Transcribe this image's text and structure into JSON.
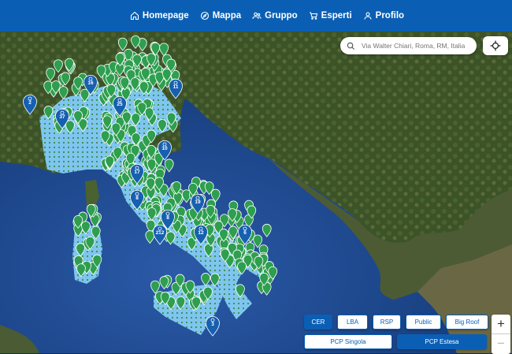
{
  "nav": {
    "items": [
      {
        "label": "Homepage",
        "icon": "home-icon"
      },
      {
        "label": "Mappa",
        "icon": "compass-icon"
      },
      {
        "label": "Gruppo",
        "icon": "group-icon"
      },
      {
        "label": "Esperti",
        "icon": "cart-icon"
      },
      {
        "label": "Profilo",
        "icon": "user-icon"
      }
    ]
  },
  "search": {
    "placeholder": "Via Walter Chiari, Roma, RM, Italia"
  },
  "filters": {
    "row1": [
      {
        "label": "CER",
        "active": true
      },
      {
        "label": "LBA",
        "active": false
      },
      {
        "label": "RSP",
        "active": false
      },
      {
        "label": "Public",
        "active": false
      },
      {
        "label": "Big Roof",
        "active": false
      }
    ],
    "row2": [
      {
        "label": "PCP Singola",
        "active": false
      },
      {
        "label": "PCP Estesa",
        "active": true
      }
    ]
  },
  "zoom": {
    "in": "+",
    "out": "−"
  },
  "clusters": [
    "2",
    "16",
    "37",
    "25",
    "11",
    "17",
    "8",
    "10",
    "8",
    "212",
    "19",
    "12",
    "6",
    "3"
  ],
  "colors": {
    "brand": "#0a5fb4",
    "pin_green": "#2e9e4f",
    "pin_blue": "#1760b0",
    "region": "#7ec6ef"
  }
}
